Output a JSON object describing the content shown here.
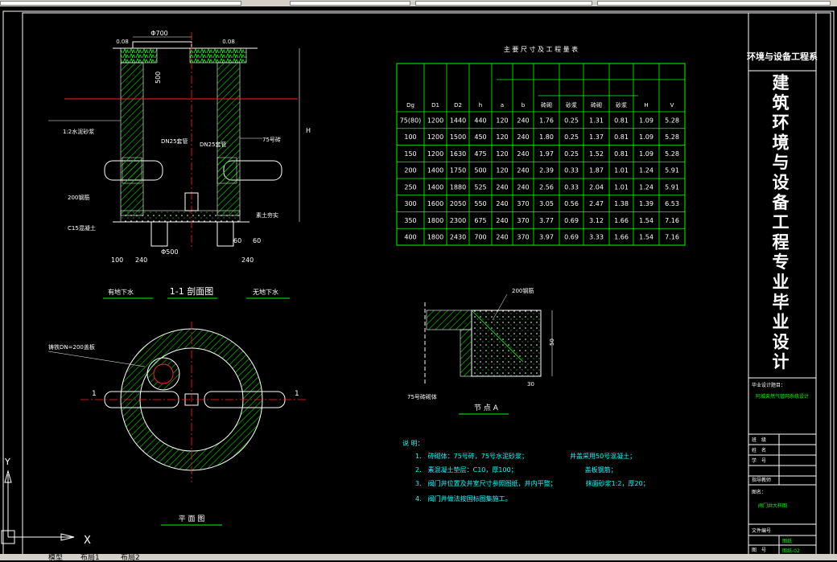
{
  "window": {
    "bottom_tabs": [
      "模型",
      "布局1",
      "布局2"
    ]
  },
  "title_block": {
    "dept": "环境与设备工程系",
    "main_title": "建筑环境与设备工程专业毕业设计",
    "project_label": "毕业设计题目：",
    "project_value": "阿城天然气管网系统设计",
    "rows": [
      "班　级",
      "姓　名",
      "学　号",
      "指导教师"
    ],
    "drawing_label": "图名：",
    "drawing_value": "阀门井大样图",
    "file_label": "文件编号",
    "page_label": "图　号",
    "page_value_a": "图纸",
    "page_value_b": "图纸-02"
  },
  "table": {
    "title": "主 要 尺 寸 及 工 程 量 表",
    "header": [
      "Dg",
      "D1",
      "D2",
      "h",
      "a",
      "b",
      "砖砌",
      "砂浆",
      "砖砌",
      "砂浆",
      "H",
      "V"
    ],
    "rows": [
      [
        "75(80)",
        "1200",
        "1440",
        "440",
        "120",
        "240",
        "1.76",
        "0.25",
        "1.31",
        "0.81",
        "1.09",
        "5.28"
      ],
      [
        "100",
        "1200",
        "1500",
        "450",
        "120",
        "240",
        "1.80",
        "0.25",
        "1.37",
        "0.81",
        "1.09",
        "5.28"
      ],
      [
        "150",
        "1200",
        "1630",
        "475",
        "120",
        "240",
        "1.97",
        "0.25",
        "1.52",
        "0.81",
        "1.09",
        "5.28"
      ],
      [
        "200",
        "1400",
        "1750",
        "500",
        "120",
        "240",
        "2.39",
        "0.33",
        "1.87",
        "1.01",
        "1.24",
        "5.91"
      ],
      [
        "250",
        "1400",
        "1880",
        "525",
        "240",
        "240",
        "2.56",
        "0.33",
        "2.04",
        "1.01",
        "1.24",
        "5.91"
      ],
      [
        "300",
        "1600",
        "2050",
        "550",
        "240",
        "370",
        "3.05",
        "0.56",
        "2.47",
        "1.38",
        "1.39",
        "6.53"
      ],
      [
        "350",
        "1800",
        "2300",
        "675",
        "240",
        "370",
        "3.77",
        "0.69",
        "3.12",
        "1.66",
        "1.54",
        "7.16"
      ],
      [
        "400",
        "1800",
        "2430",
        "700",
        "240",
        "370",
        "3.97",
        "0.69",
        "3.33",
        "1.66",
        "1.54",
        "7.16"
      ]
    ]
  },
  "section": {
    "title": "1-1 剖面图",
    "left_label": "有地下水",
    "right_label": "无地下水",
    "dims": [
      "Φ700",
      "0.08",
      "0.08",
      "500",
      "240",
      "100",
      "Φ500",
      "240",
      "60",
      "60",
      "H",
      "DN25套管",
      "DN25套管",
      "200钢筋",
      "1:2水泥砂浆",
      "C15混凝土",
      "75号砖",
      "素土夯实"
    ]
  },
  "plan": {
    "title": "平 面 图",
    "dims": [
      "1",
      "1"
    ],
    "note": "铸铁DN=200盖板"
  },
  "detail": {
    "title": "节 点 A",
    "dims": [
      "200钢筋",
      "50",
      "30",
      "75号砖砌体"
    ]
  },
  "notes": {
    "title": "说 明：",
    "items": [
      "1.　砖砌体：75号砖，75号水泥砂浆；　　　　　　　井盖采用50号混凝土；",
      "2.　素混凝土垫层：C10，厚100；　　　　　　　　　　　盖板钢筋；",
      "3.　阀门井位置及井室尺寸参照图纸，井内平整；　　　　　抹面砂浆1:2，厚20；",
      "4.　阀门井做法按国标图集施工。"
    ]
  },
  "ucs": {
    "y": "Y",
    "x": "X"
  }
}
